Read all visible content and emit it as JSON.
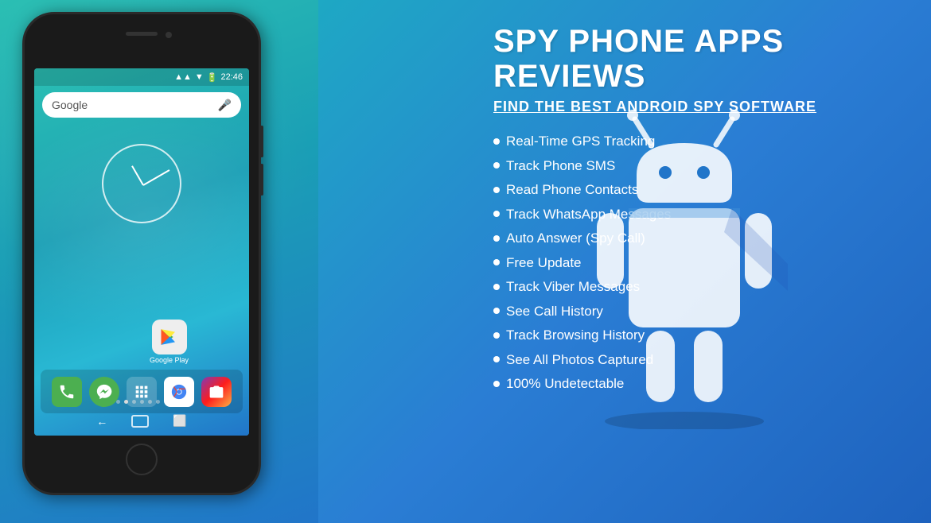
{
  "title": "SPY PHONE APPS REVIEWS",
  "subtitle": "FIND THE BEST ANDROID SPY SOFTWARE",
  "features": [
    "Real-Time GPS Tracking",
    "Track Phone SMS",
    "Read Phone Contacts",
    "Track WhatsApp Messages",
    "Auto Answer (Spy Call)",
    "Free Update",
    "Track Viber Messages",
    "See Call History",
    "Track Browsing History",
    "See All Photos Captured",
    "100% Undetectable"
  ],
  "phone": {
    "time": "22:46",
    "search_placeholder": "Google"
  },
  "colors": {
    "teal": "#2bbfb3",
    "blue": "#2175c9",
    "dark_blue": "#1a5fc0",
    "mid_blue": "#1a9fb5",
    "bg_left": "#20b5c0",
    "bg_right": "#2068c4"
  }
}
